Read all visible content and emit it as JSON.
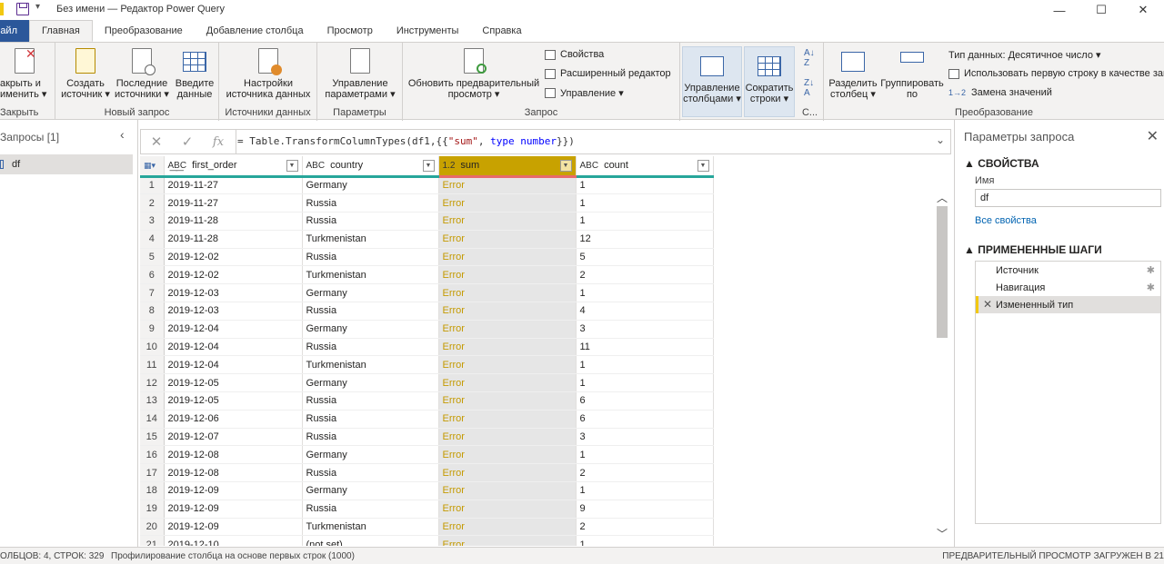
{
  "titlebar": {
    "title": "Без имени — Редактор Power Query",
    "qat": "▾",
    "minimize": "—",
    "maximize": "☐",
    "close": "✕"
  },
  "tabs": [
    "айл",
    "Главная",
    "Преобразование",
    "Добавление столбца",
    "Просмотр",
    "Инструменты",
    "Справка"
  ],
  "ribbon": {
    "close_group": {
      "label": "Закрыть",
      "btn": "акрыть и\nименить ▾"
    },
    "newquery_group": {
      "label": "Новый запрос",
      "btn_new": "Создать\nисточник ▾",
      "btn_recent": "Последние\nисточники ▾",
      "btn_enter": "Введите\nданные"
    },
    "datasource_group": {
      "label": "Источники данных",
      "btn": "Настройки\nисточника данных"
    },
    "params_group": {
      "label": "Параметры",
      "btn": "Управление\nпараметрами ▾"
    },
    "query_group": {
      "label": "Запрос",
      "btn_refresh": "Обновить предварительный\nпросмотр ▾",
      "item_props": "Свойства",
      "item_adv": "Расширенный редактор",
      "item_manage": "Управление ▾"
    },
    "manage_cols": "Управление\nстолбцами ▾",
    "reduce_rows": "Сократить\nстроки ▾",
    "sort_label": "С...",
    "transform_group": {
      "label": "Преобразование",
      "btn_split": "Разделить\nстолбец ▾",
      "btn_group": "Группировать\nпо",
      "item_type": "Тип данных: Десятичное число ▾",
      "item_firstrow": "Использовать первую строку в качестве заг",
      "item_replace": "Замена значений"
    }
  },
  "left_pane": {
    "title": "Запросы [1]",
    "chevron": "‹",
    "item": "df"
  },
  "formula": {
    "cancel": "✕",
    "ok": "✓",
    "fx": "fx",
    "prefix": "= Table.TransformColumnTypes(df1,{{",
    "str": "\"sum\"",
    "mid": ", ",
    "kw": "type number",
    "suffix": "}})",
    "expand": "⌄"
  },
  "table": {
    "columns": [
      {
        "type": "A͟B͟C",
        "name": "first_order"
      },
      {
        "type": "ABC",
        "name": "country"
      },
      {
        "type": "1.2",
        "name": "sum"
      },
      {
        "type": "ABC",
        "name": "count"
      }
    ],
    "rows": [
      [
        "1",
        "2019-11-27",
        "Germany",
        "Error",
        "1"
      ],
      [
        "2",
        "2019-11-27",
        "Russia",
        "Error",
        "1"
      ],
      [
        "3",
        "2019-11-28",
        "Russia",
        "Error",
        "1"
      ],
      [
        "4",
        "2019-11-28",
        "Turkmenistan",
        "Error",
        "12"
      ],
      [
        "5",
        "2019-12-02",
        "Russia",
        "Error",
        "5"
      ],
      [
        "6",
        "2019-12-02",
        "Turkmenistan",
        "Error",
        "2"
      ],
      [
        "7",
        "2019-12-03",
        "Germany",
        "Error",
        "1"
      ],
      [
        "8",
        "2019-12-03",
        "Russia",
        "Error",
        "4"
      ],
      [
        "9",
        "2019-12-04",
        "Germany",
        "Error",
        "3"
      ],
      [
        "10",
        "2019-12-04",
        "Russia",
        "Error",
        "11"
      ],
      [
        "11",
        "2019-12-04",
        "Turkmenistan",
        "Error",
        "1"
      ],
      [
        "12",
        "2019-12-05",
        "Germany",
        "Error",
        "1"
      ],
      [
        "13",
        "2019-12-05",
        "Russia",
        "Error",
        "6"
      ],
      [
        "14",
        "2019-12-06",
        "Russia",
        "Error",
        "6"
      ],
      [
        "15",
        "2019-12-07",
        "Russia",
        "Error",
        "3"
      ],
      [
        "16",
        "2019-12-08",
        "Germany",
        "Error",
        "1"
      ],
      [
        "17",
        "2019-12-08",
        "Russia",
        "Error",
        "2"
      ],
      [
        "18",
        "2019-12-09",
        "Germany",
        "Error",
        "1"
      ],
      [
        "19",
        "2019-12-09",
        "Russia",
        "Error",
        "9"
      ],
      [
        "20",
        "2019-12-09",
        "Turkmenistan",
        "Error",
        "2"
      ],
      [
        "21",
        "2019-12-10",
        "(not set)",
        "Error",
        "1"
      ]
    ]
  },
  "right_pane": {
    "title": "Параметры запроса",
    "close": "✕",
    "props_section": "▲ СВОЙСТВА",
    "name_label": "Имя",
    "name_value": "df",
    "all_props": "Все свойства",
    "steps_section": "▲ ПРИМЕНЕННЫЕ ШАГИ",
    "steps": [
      "Источник",
      "Навигация",
      "Измененный тип"
    ]
  },
  "status": {
    "left": "ОЛБЦОВ: 4, СТРОК: 329",
    "mid": "Профилирование столбца на основе первых строк (1000)",
    "right": "ПРЕДВАРИТЕЛЬНЫЙ ПРОСМОТР ЗАГРУЖЕН В 21"
  }
}
